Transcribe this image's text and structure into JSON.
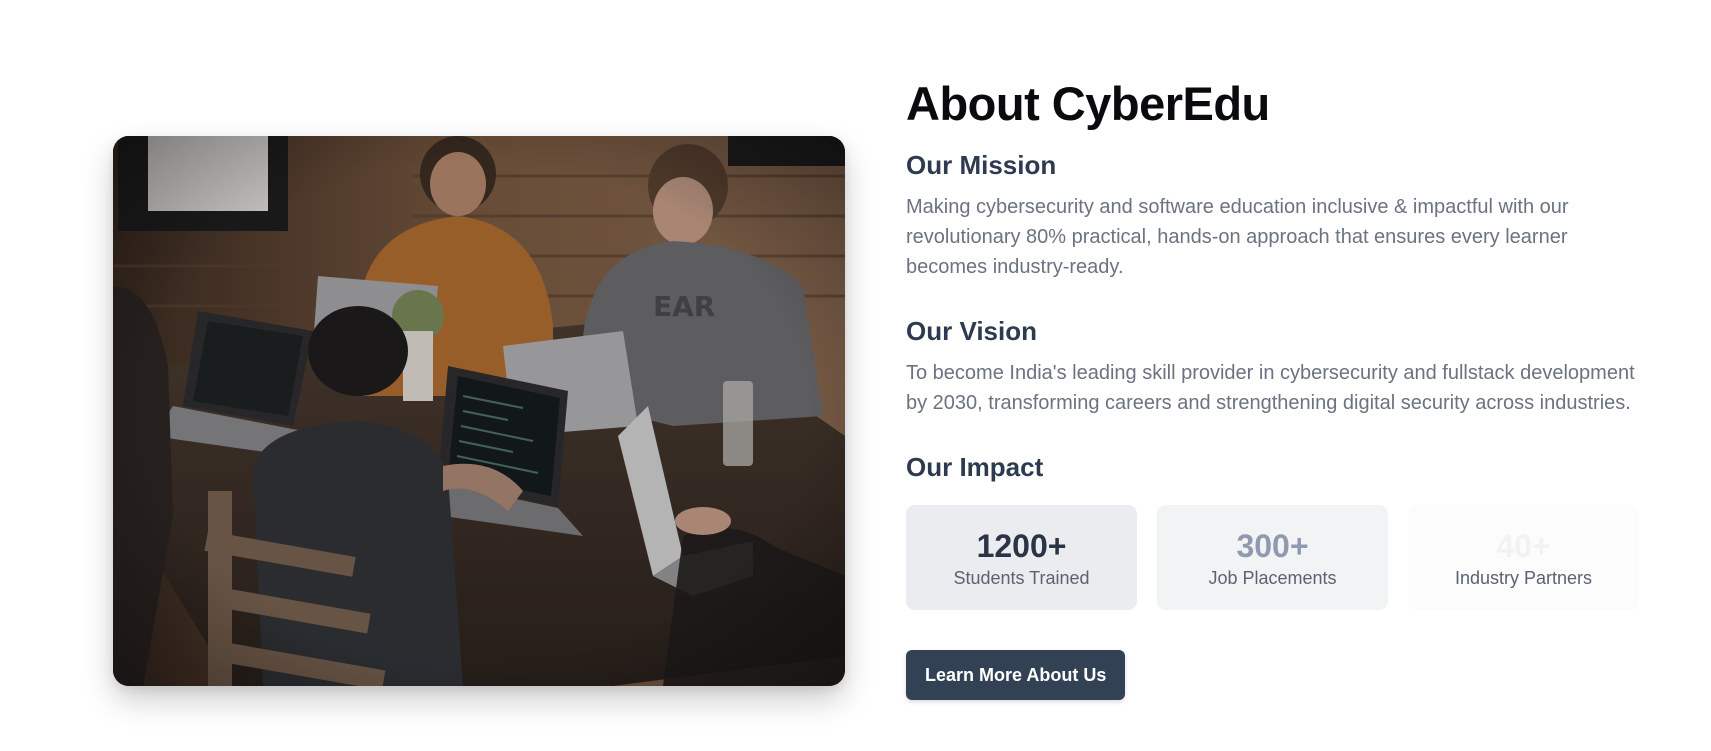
{
  "about": {
    "title": "About CyberEdu",
    "mission": {
      "heading": "Our Mission",
      "text": "Making cybersecurity and software education inclusive & impactful with our revolutionary 80% practical, hands-on approach that ensures every learner becomes industry-ready."
    },
    "vision": {
      "heading": "Our Vision",
      "text": "To become India's leading skill provider in cybersecurity and fullstack development by 2030, transforming careers and strengthening digital security across industries."
    },
    "impact": {
      "heading": "Our Impact",
      "stats": [
        {
          "value": "1200+",
          "label": "Students Trained"
        },
        {
          "value": "300+",
          "label": "Job Placements"
        },
        {
          "value": "40+",
          "label": "Industry Partners"
        }
      ]
    },
    "cta_label": "Learn More About Us"
  },
  "colors": {
    "primary": "#334155",
    "heading": "#2e3a4f",
    "body_text": "#6b7280"
  }
}
